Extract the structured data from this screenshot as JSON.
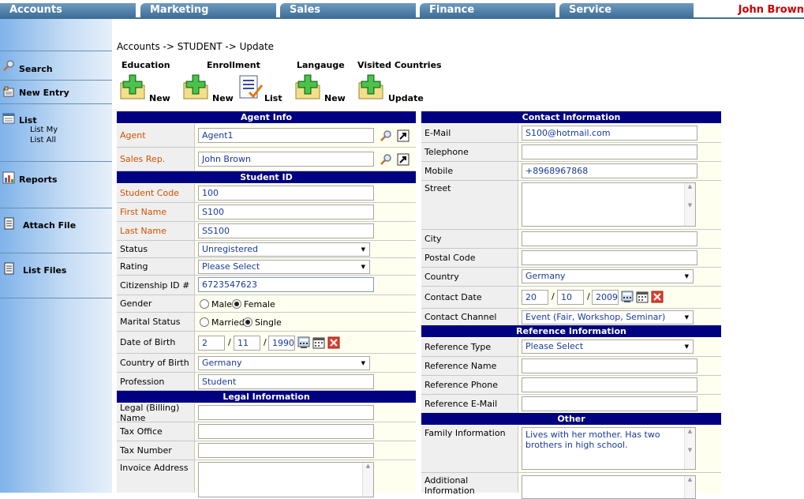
{
  "tabs": [
    "Accounts",
    "Marketing",
    "Sales",
    "Finance",
    "Service"
  ],
  "user": "John Brown",
  "sidebar": {
    "search": "Search",
    "new_entry": "New Entry",
    "list": "List",
    "list_my": "List My",
    "list_all": "List All",
    "reports": "Reports",
    "attach_file": "Attach File",
    "list_files": "List Files"
  },
  "breadcrumb": "Accounts -> STUDENT -> Update",
  "toolbar": {
    "education": "Education",
    "education_new": "New",
    "enrollment": "Enrollment",
    "enrollment_new": "New",
    "enrollment_list": "List",
    "language": "Langauge",
    "language_new": "New",
    "visited": "Visited Countries",
    "visited_update": "Update"
  },
  "agent_info": {
    "title": "Agent Info",
    "agent_label": "Agent",
    "agent_value": "Agent1",
    "salesrep_label": "Sales Rep.",
    "salesrep_value": "John Brown"
  },
  "student_id": {
    "title": "Student ID",
    "code_label": "Student Code",
    "code_value": "100",
    "first_label": "First Name",
    "first_value": "S100",
    "last_label": "Last Name",
    "last_value": "SS100",
    "status_label": "Status",
    "status_value": "Unregistered",
    "rating_label": "Rating",
    "rating_value": "Please Select",
    "citizen_label": "Citizenship ID #",
    "citizen_value": "6723547623",
    "gender_label": "Gender",
    "gender_male": "Male",
    "gender_female": "Female",
    "marital_label": "Marital Status",
    "marital_married": "Married",
    "marital_single": "Single",
    "dob_label": "Date of Birth",
    "dob_day": "2",
    "dob_month": "11",
    "dob_year": "1990",
    "cob_label": "Country of Birth",
    "cob_value": "Germany",
    "profession_label": "Profession",
    "profession_value": "Student"
  },
  "legal": {
    "title": "Legal Information",
    "billing_label": "Legal (Billing) Name",
    "taxoffice_label": "Tax Office",
    "taxnumber_label": "Tax Number",
    "invoice_label": "Invoice Address"
  },
  "contact": {
    "title": "Contact Information",
    "email_label": "E-Mail",
    "email_value": "S100@hotmail.com",
    "telephone_label": "Telephone",
    "mobile_label": "Mobile",
    "mobile_value": "+8968967868",
    "street_label": "Street",
    "city_label": "City",
    "postal_label": "Postal Code",
    "country_label": "Country",
    "country_value": "Germany",
    "contactdate_label": "Contact Date",
    "cd_day": "20",
    "cd_month": "10",
    "cd_year": "2009",
    "channel_label": "Contact Channel",
    "channel_value": "Event (Fair, Workshop, Seminar)"
  },
  "reference": {
    "title": "Reference Information",
    "type_label": "Reference Type",
    "type_value": "Please Select",
    "name_label": "Reference Name",
    "phone_label": "Reference Phone",
    "email_label": "Reference E-Mail"
  },
  "other": {
    "title": "Other",
    "family_label": "Family Information",
    "family_value": "Lives with her mother. Has two brothers in high school.",
    "additional_label": "Additional Information"
  },
  "date_sep": "/",
  "colors": {
    "header_bg": "#000080",
    "required": "#d45000",
    "user": "#cc0000"
  }
}
